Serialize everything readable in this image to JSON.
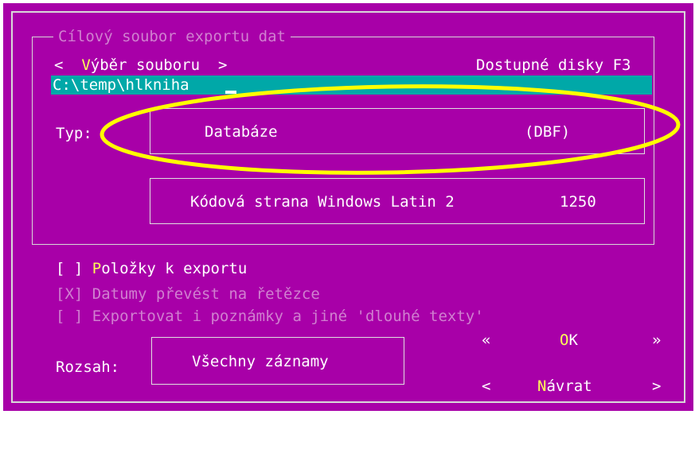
{
  "dialog": {
    "group_title": "Cílový soubor exportu dat",
    "file_select": {
      "left_arrow": "<",
      "hotkey": "V",
      "rest": "ýběr souboru",
      "right_arrow": ">"
    },
    "disks_label": "Dostupné disky F3",
    "path_value": "C:\\temp\\hlkniha",
    "type_label": "Typ:",
    "type_name": "Databáze",
    "type_ext": "(DBF)",
    "codepage_label": "Kódová strana Windows Latin 2",
    "codepage_value": "1250",
    "options": [
      {
        "box": "[ ]",
        "hotkey": "P",
        "label": "oložky k exportu",
        "enabled": true
      },
      {
        "box": "[X]",
        "hotkey": "",
        "label": "Datumy převést na řetězce",
        "enabled": false
      },
      {
        "box": "[ ]",
        "hotkey": "",
        "label": "Exportovat i poznámky a jiné 'dlouhé texty'",
        "enabled": false
      }
    ],
    "range_label": "Rozsah:",
    "range_value": "Všechny záznamy",
    "ok": {
      "left": "«",
      "hotkey": "O",
      "rest": "K",
      "right": "»"
    },
    "back": {
      "left": "<",
      "hotkey": "N",
      "rest": "ávrat",
      "right": ">"
    }
  },
  "colors": {
    "background": "#a800a8",
    "highlight": "#ffff55",
    "input": "#00a8a8",
    "annotation": "#ffff00"
  }
}
